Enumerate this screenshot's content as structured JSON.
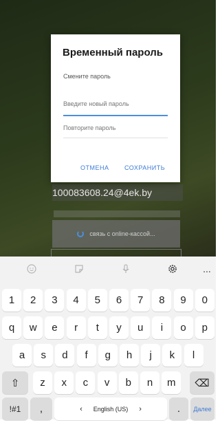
{
  "background": {
    "email_text": "100083608.24@4ek.by",
    "loading_text": "связь с online-кассой..."
  },
  "dialog": {
    "title": "Временный пароль",
    "subtitle": "Смените пароль",
    "new_password_placeholder": "Введите новый пароль",
    "repeat_password_placeholder": "Повторите пароль",
    "cancel_label": "ОТМЕНА",
    "save_label": "СОХРАНИТЬ"
  },
  "keyboard": {
    "toolbar_icons": [
      "emoji-icon",
      "sticker-icon",
      "mic-icon",
      "settings-icon",
      "more-icon"
    ],
    "more_label": "...",
    "digits": [
      "1",
      "2",
      "3",
      "4",
      "5",
      "6",
      "7",
      "8",
      "9",
      "0"
    ],
    "row1": [
      "q",
      "w",
      "e",
      "r",
      "t",
      "y",
      "u",
      "i",
      "o",
      "p"
    ],
    "row2": [
      "a",
      "s",
      "d",
      "f",
      "g",
      "h",
      "j",
      "k",
      "l"
    ],
    "row3": [
      "z",
      "x",
      "c",
      "v",
      "b",
      "n",
      "m"
    ],
    "symbols_label": "!#1",
    "comma_label": ",",
    "lang_label": "English (US)",
    "lang_prev": "‹",
    "lang_next": "›",
    "period_label": ".",
    "enter_label": "Далее",
    "shift_symbol": "⇧",
    "backspace_symbol": "⌫"
  },
  "colors": {
    "accent": "#3d7bd6",
    "field_focus": "#4a8fe0"
  }
}
